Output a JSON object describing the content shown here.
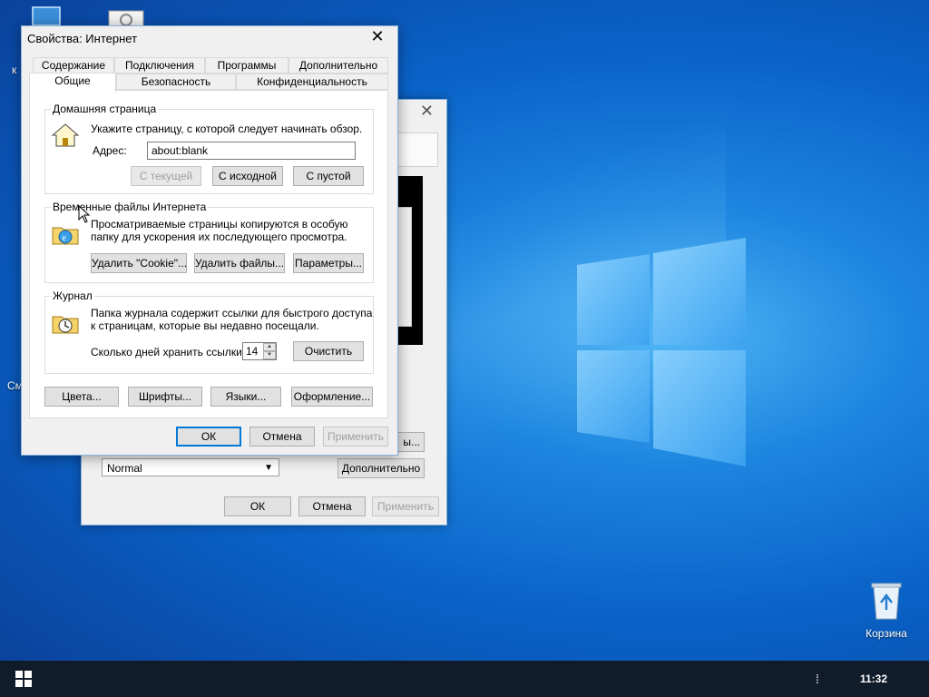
{
  "desktop": {
    "recycle_bin_label": "Корзина",
    "partial_label_1": "к",
    "partial_label_2": "См"
  },
  "taskbar": {
    "clock": "11:32"
  },
  "background_dialog": {
    "tab_text_1": "а",
    "tab_text_2": "ы",
    "dropdown_value": "Normal",
    "button_partial": "ы...",
    "advanced_button": "Дополнительно",
    "ok": "ОК",
    "cancel": "Отмена",
    "apply": "Применить"
  },
  "dialog": {
    "title": "Свойства: Интернет",
    "tabs_back": [
      "Содержание",
      "Подключения",
      "Программы",
      "Дополнительно"
    ],
    "tabs_front": [
      "Общие",
      "Безопасность",
      "Конфиденциальность"
    ],
    "home": {
      "legend": "Домашняя страница",
      "description": "Укажите страницу, с которой следует начинать обзор.",
      "address_label": "Адрес:",
      "address_value": "about:blank",
      "btn_current": "С текущей",
      "btn_default": "С исходной",
      "btn_blank": "С пустой"
    },
    "temp": {
      "legend": "Временные файлы Интернета",
      "description_1": "Просматриваемые страницы копируются в особую",
      "description_2": "папку для ускорения их последующего просмотра.",
      "btn_cookies": "Удалить \"Cookie\"...",
      "btn_files": "Удалить файлы...",
      "btn_settings": "Параметры..."
    },
    "history": {
      "legend": "Журнал",
      "description_1": "Папка журнала содержит ссылки для быстрого доступа",
      "description_2": "к страницам, которые вы недавно посещали.",
      "days_label": "Сколько дней хранить ссылки:",
      "days_value": "14",
      "btn_clear": "Очистить"
    },
    "bottom_buttons": {
      "colors": "Цвета...",
      "fonts": "Шрифты...",
      "languages": "Языки...",
      "accessibility": "Оформление..."
    },
    "ok": "ОК",
    "cancel": "Отмена",
    "apply": "Применить"
  }
}
